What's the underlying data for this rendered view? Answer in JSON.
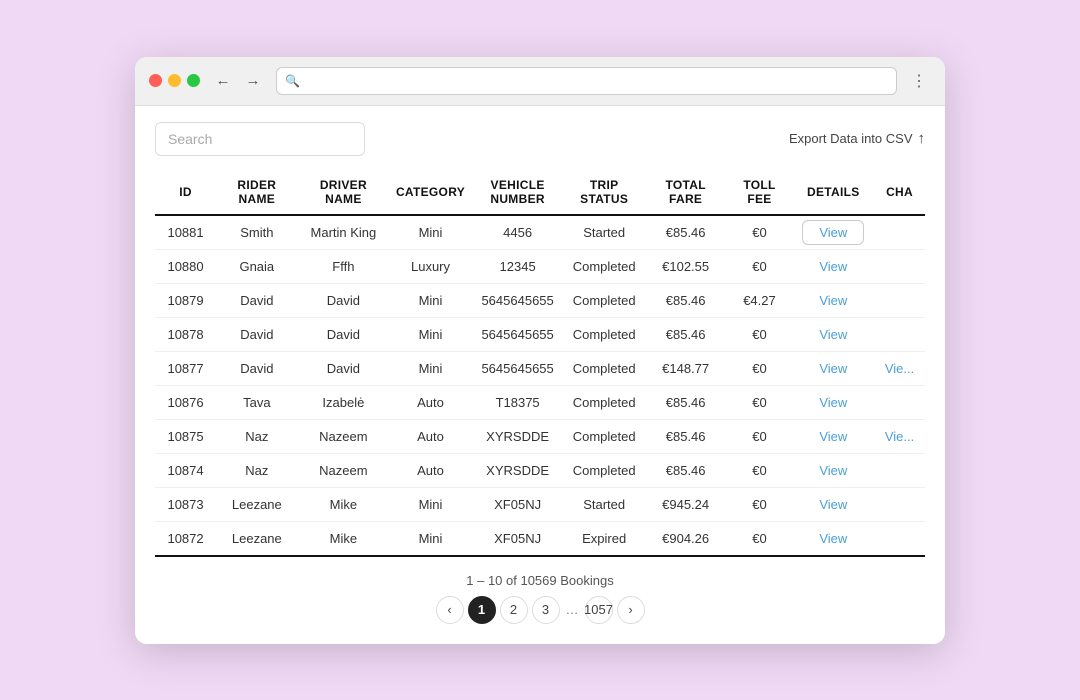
{
  "browser": {
    "back_icon": "←",
    "forward_icon": "→",
    "search_icon": "🔍",
    "menu_icon": "⋮"
  },
  "toolbar": {
    "search_placeholder": "Search",
    "export_label": "Export Data into CSV",
    "export_icon": "↑"
  },
  "table": {
    "columns": [
      {
        "key": "id",
        "label": "ID"
      },
      {
        "key": "rider_name",
        "label": "RIDER NAME"
      },
      {
        "key": "driver_name",
        "label": "DRIVER NAME"
      },
      {
        "key": "category",
        "label": "CATEGORY"
      },
      {
        "key": "vehicle_number",
        "label": "VEHICLE NUMBER"
      },
      {
        "key": "trip_status",
        "label": "TRIP STATUS"
      },
      {
        "key": "total_fare",
        "label": "TOTAL FARE"
      },
      {
        "key": "toll_fee",
        "label": "TOLL FEE"
      },
      {
        "key": "details",
        "label": "DETAILS"
      },
      {
        "key": "charge",
        "label": "CHA..."
      }
    ],
    "rows": [
      {
        "id": "10881",
        "rider": "Smith",
        "driver": "Martin King",
        "category": "Mini",
        "vehicle": "4456",
        "status": "Started",
        "fare": "€85.46",
        "toll": "€0",
        "details": "View",
        "charge": "",
        "highlighted": true
      },
      {
        "id": "10880",
        "rider": "Gnaia",
        "driver": "Fffh",
        "category": "Luxury",
        "vehicle": "12345",
        "status": "Completed",
        "fare": "€102.55",
        "toll": "€0",
        "details": "View",
        "charge": ""
      },
      {
        "id": "10879",
        "rider": "David",
        "driver": "David",
        "category": "Mini",
        "vehicle": "5645645655",
        "status": "Completed",
        "fare": "€85.46",
        "toll": "€4.27",
        "details": "View",
        "charge": ""
      },
      {
        "id": "10878",
        "rider": "David",
        "driver": "David",
        "category": "Mini",
        "vehicle": "5645645655",
        "status": "Completed",
        "fare": "€85.46",
        "toll": "€0",
        "details": "View",
        "charge": ""
      },
      {
        "id": "10877",
        "rider": "David",
        "driver": "David",
        "category": "Mini",
        "vehicle": "5645645655",
        "status": "Completed",
        "fare": "€148.77",
        "toll": "€0",
        "details": "View",
        "charge": "Vie..."
      },
      {
        "id": "10876",
        "rider": "Tava",
        "driver": "Izabelė",
        "category": "Auto",
        "vehicle": "T18375",
        "status": "Completed",
        "fare": "€85.46",
        "toll": "€0",
        "details": "View",
        "charge": ""
      },
      {
        "id": "10875",
        "rider": "Naz",
        "driver": "Nazeem",
        "category": "Auto",
        "vehicle": "XYRSDDE",
        "status": "Completed",
        "fare": "€85.46",
        "toll": "€0",
        "details": "View",
        "charge": "Vie..."
      },
      {
        "id": "10874",
        "rider": "Naz",
        "driver": "Nazeem",
        "category": "Auto",
        "vehicle": "XYRSDDE",
        "status": "Completed",
        "fare": "€85.46",
        "toll": "€0",
        "details": "View",
        "charge": ""
      },
      {
        "id": "10873",
        "rider": "Leezane",
        "driver": "Mike",
        "category": "Mini",
        "vehicle": "XF05NJ",
        "status": "Started",
        "fare": "€945.24",
        "toll": "€0",
        "details": "View",
        "charge": ""
      },
      {
        "id": "10872",
        "rider": "Leezane",
        "driver": "Mike",
        "category": "Mini",
        "vehicle": "XF05NJ",
        "status": "Expired",
        "fare": "€904.26",
        "toll": "€0",
        "details": "View",
        "charge": ""
      }
    ]
  },
  "pagination": {
    "info": "1 – 10 of 10569 Bookings",
    "prev_icon": "‹",
    "next_icon": "›",
    "pages": [
      "1",
      "2",
      "3",
      "...",
      "1057"
    ]
  }
}
